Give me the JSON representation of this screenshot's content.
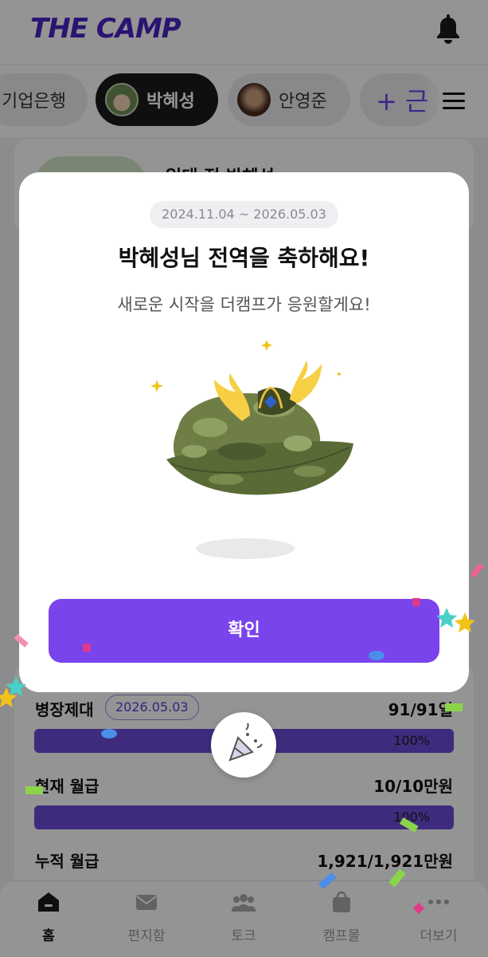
{
  "app": {
    "logo": "THE CAMP",
    "tabs": [
      {
        "label": "기업은행"
      },
      {
        "label": "박혜성"
      },
      {
        "label": "안영준"
      },
      {
        "label": "+ 근"
      }
    ],
    "profile_card_title": "입대 전 박혜성"
  },
  "modal": {
    "period": "2024.11.04 ~ 2026.05.03",
    "headline": "박혜성님 전역을 축하해요!",
    "subline": "새로운 시작을 더캠프가 응원할게요!",
    "confirm_label": "확인"
  },
  "stats": [
    {
      "label": "병장제대",
      "badge": "2026.05.03",
      "value": "91/91일",
      "progress_pct": 100,
      "progress_text": "100%"
    },
    {
      "label": "현재 월급",
      "value": "10/10만원",
      "progress_pct": 100,
      "progress_text": "100%"
    },
    {
      "label": "누적 월급",
      "value": "1,921/1,921만원"
    }
  ],
  "bottom_nav": [
    {
      "label": "홈",
      "icon": "home-icon",
      "active": true
    },
    {
      "label": "편지함",
      "icon": "mail-icon",
      "active": false
    },
    {
      "label": "토크",
      "icon": "people-icon",
      "active": false
    },
    {
      "label": "캠프몰",
      "icon": "shopping-bag-icon",
      "active": false
    },
    {
      "label": "더보기",
      "icon": "more-icon",
      "active": false
    }
  ],
  "colors": {
    "brand": "#4a22c4",
    "accent": "#7a44ec",
    "progress": "#6c4bd8"
  }
}
